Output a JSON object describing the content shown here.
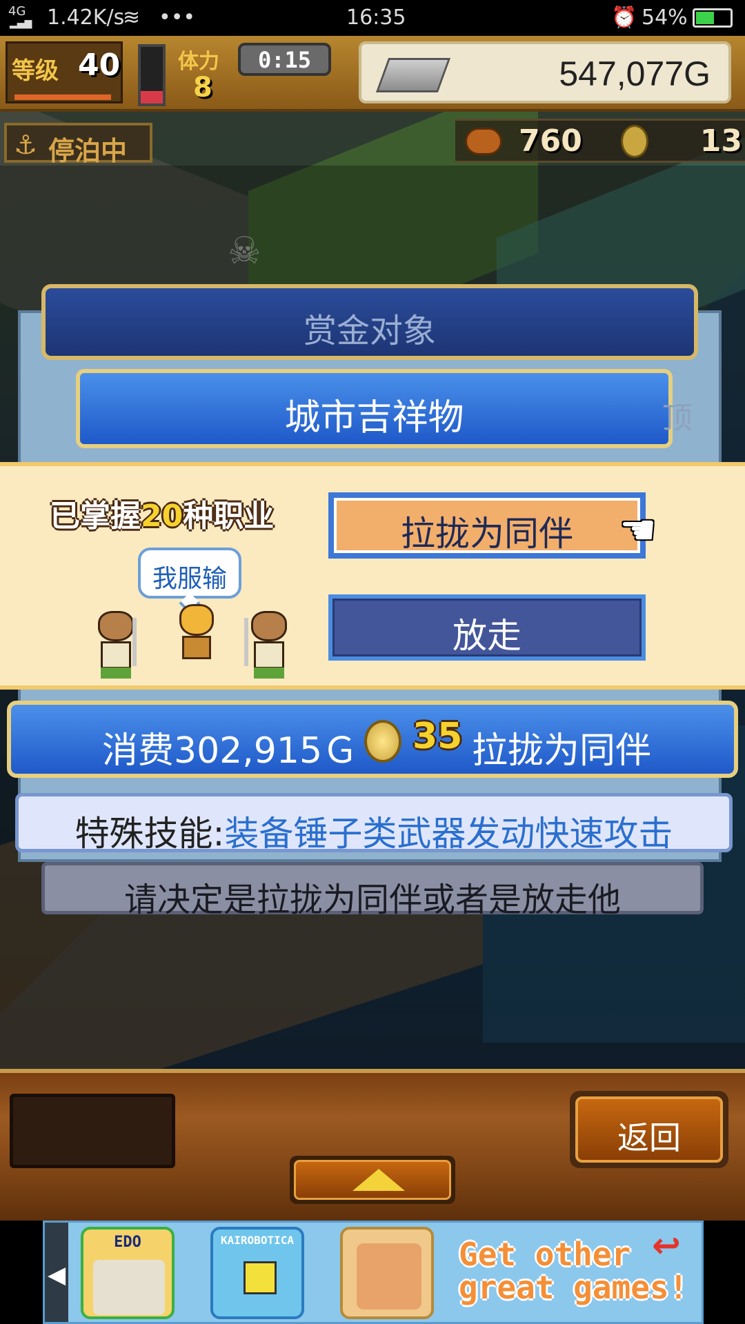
{
  "status_bar": {
    "network": "4G",
    "speed": "1.42K/s",
    "more": "•••",
    "time": "16:35",
    "battery": "54%"
  },
  "hud": {
    "level_label": "等级",
    "level": "40",
    "stamina_label": "体力",
    "stamina": "8",
    "stamina_level": 0.22,
    "timer": "0:15",
    "gold": "547,077G",
    "dock_status": "停泊中",
    "food": "760",
    "medals": "13"
  },
  "bounty": {
    "header": "赏金对象",
    "target_name": "城市吉祥物",
    "side_glyph": "顶"
  },
  "choice": {
    "mastered_prefix": "已掌握",
    "mastered_count": "20",
    "mastered_suffix": "种职业",
    "speech": "我服输",
    "recruit_label": "拉拢为同伴",
    "release_label": "放走"
  },
  "cost": {
    "prefix": "消费302,915Ｇ",
    "coins": "35",
    "suffix": "拉拢为同伴"
  },
  "skill": {
    "label": "特殊技能:",
    "value": "装备锤子类武器发动快速攻击"
  },
  "instruction": "请决定是拉拢为同伴或者是放走他",
  "bottom": {
    "back_label": "返回"
  },
  "ad": {
    "games": [
      "EDO",
      "KAIROBOTICA",
      ""
    ],
    "cta_line1": "Get other",
    "cta_line2": "great games!"
  },
  "colors": {
    "recruit_button": "#f2ae6b",
    "release_button": "#44569a",
    "cost_bar": "#1f59c9",
    "skill_highlight": "#2a6fcf"
  }
}
